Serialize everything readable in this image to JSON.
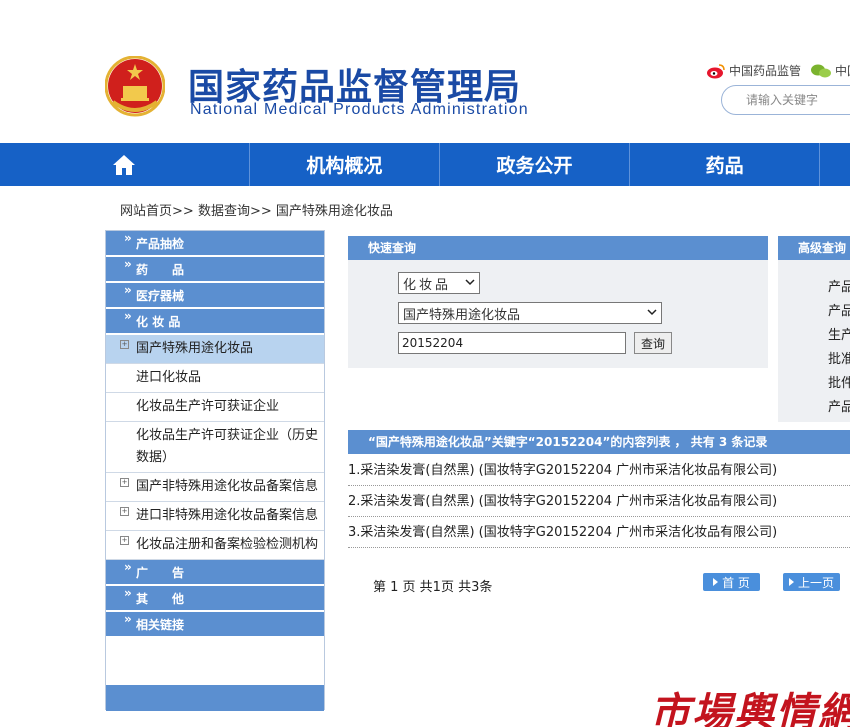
{
  "header": {
    "title_cn": "国家药品监督管理局",
    "title_en": "National Medical Products Administration",
    "weibo_label": "中国药品监管",
    "wechat_label": "中国",
    "search_placeholder": "请输入关键字"
  },
  "nav": {
    "items": [
      {
        "label": "机构概况"
      },
      {
        "label": "政务公开"
      },
      {
        "label": "药品"
      },
      {
        "label": ""
      }
    ]
  },
  "breadcrumb": {
    "home": "网站首页",
    "sep": ">>",
    "data_query": "数据查询",
    "current": "国产特殊用途化妆品"
  },
  "sidebar": {
    "chev": "»",
    "sections": [
      {
        "label": "产品抽检"
      },
      {
        "label": "药　　品"
      },
      {
        "label": "医疗器械"
      },
      {
        "label": "化 妆 品"
      }
    ],
    "sub_items": [
      {
        "label": "国产特殊用途化妆品"
      },
      {
        "label": "进口化妆品"
      },
      {
        "label": "化妆品生产许可获证企业"
      },
      {
        "label": "化妆品生产许可获证企业（历史数据）"
      },
      {
        "label": "国产非特殊用途化妆品备案信息"
      },
      {
        "label": "进口非特殊用途化妆品备案信息"
      },
      {
        "label": "化妆品注册和备案检验检测机构"
      }
    ],
    "bottom_sections": [
      {
        "label": "广　　告"
      },
      {
        "label": "其　　他"
      },
      {
        "label": "相关链接"
      }
    ]
  },
  "quick_search": {
    "title": "快速查询",
    "category": "化妆品",
    "database": "国产特殊用途化妆品",
    "keyword": "20152204",
    "button": "查询"
  },
  "advanced_search": {
    "title": "高级查询",
    "lines": [
      "产品",
      "产品",
      "生产",
      "批准",
      "批件",
      "产品"
    ]
  },
  "results": {
    "header": "“国产特殊用途化妆品”关键字“20152204”的内容列表 ， 共有 3 条记录",
    "rows": [
      "1.采洁染发膏(自然黑) (国妆特字G20152204 广州市采洁化妆品有限公司)",
      "2.采洁染发膏(自然黑) (国妆特字G20152204 广州市采洁化妆品有限公司)",
      "3.采洁染发膏(自然黑) (国妆特字G20152204 广州市采洁化妆品有限公司)"
    ]
  },
  "pager": {
    "text": "第 1 页 共1页 共3条",
    "first": "首 页",
    "prev": "上一页"
  },
  "watermark": "市場輿情網",
  "colors": {
    "nav_blue": "#1661c6",
    "panel_blue": "#5b8fd0",
    "title_blue": "#1a4aa5",
    "watermark_red": "#c3141e"
  }
}
